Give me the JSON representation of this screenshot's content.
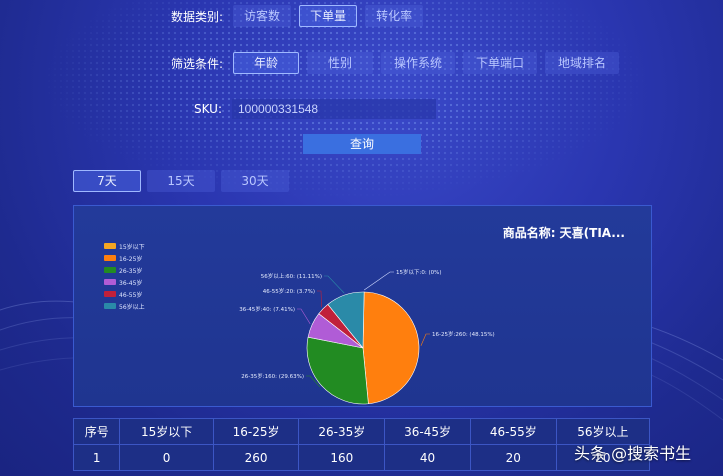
{
  "filters": {
    "data_type_label": "数据类别:",
    "data_types": [
      "访客数",
      "下单量",
      "转化率"
    ],
    "condition_label": "筛选条件:",
    "conditions": [
      "年龄",
      "性别",
      "操作系统",
      "下单端口",
      "地域排名"
    ],
    "sku_label": "SKU:",
    "sku_value": "100000331548",
    "query_label": "查询"
  },
  "ranges": [
    "7天",
    "15天",
    "30天"
  ],
  "chart_panel": {
    "product_title": "商品名称: 天喜(TIA...",
    "legend": [
      "15岁以下",
      "16-25岁",
      "26-35岁",
      "36-45岁",
      "46-55岁",
      "56岁以上"
    ],
    "labels": [
      "15岁以下:0: (0%)",
      "16-25岁:260: (48.15%)",
      "26-35岁:160: (29.63%)",
      "36-45岁:40: (7.41%)",
      "46-55岁:20: (3.7%)",
      "56岁以上:60: (11.11%)"
    ]
  },
  "chart_data": {
    "type": "pie",
    "categories": [
      "15岁以下",
      "16-25岁",
      "26-35岁",
      "36-45岁",
      "46-55岁",
      "56岁以上"
    ],
    "values": [
      0,
      260,
      160,
      40,
      20,
      60
    ],
    "percentages": [
      0,
      48.15,
      29.63,
      7.41,
      3.7,
      11.11
    ],
    "colors": [
      "#f4a623",
      "#ff7f0e",
      "#228b22",
      "#b05cd6",
      "#c0203a",
      "#2a8aa8"
    ],
    "legend_position": "top-left"
  },
  "table": {
    "headers": [
      "序号",
      "15岁以下",
      "16-25岁",
      "26-35岁",
      "36-45岁",
      "46-55岁",
      "56岁以上"
    ],
    "rows": [
      [
        "1",
        "0",
        "260",
        "160",
        "40",
        "20",
        "20"
      ]
    ]
  },
  "watermark": "头条 @搜索书生"
}
